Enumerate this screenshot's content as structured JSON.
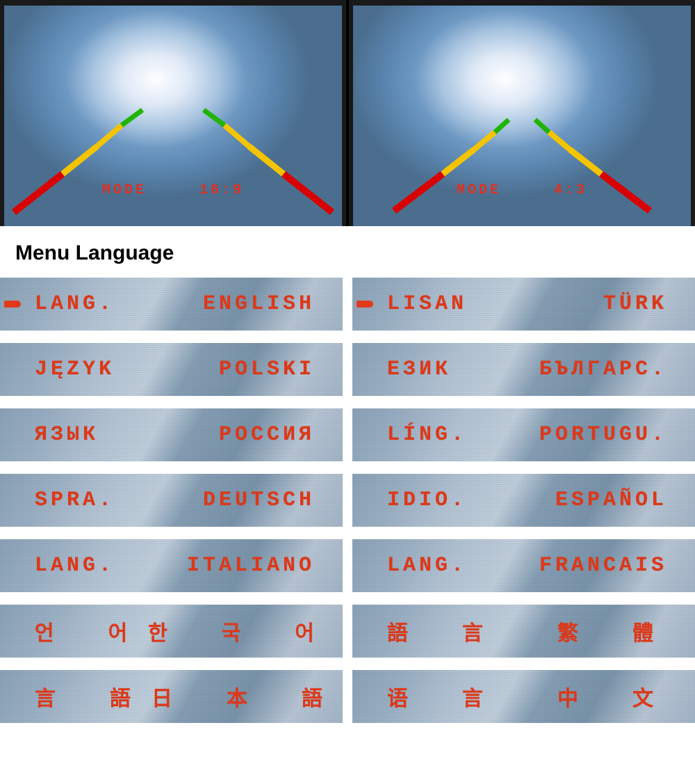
{
  "screens": {
    "left": {
      "mode_label": "MODE",
      "aspect": "16:9"
    },
    "right": {
      "mode_label": "MODE",
      "aspect": "4:3"
    }
  },
  "heading": "Menu Language",
  "languages": [
    {
      "label": "LANG.",
      "value": "ENGLISH",
      "indicator": true,
      "spaced": false
    },
    {
      "label": "LISAN",
      "value": "TÜRK",
      "indicator": true,
      "spaced": false
    },
    {
      "label": "JĘZYK",
      "value": "POLSKI",
      "indicator": false,
      "spaced": false
    },
    {
      "label": "ЕЗИК",
      "value": "БЪЛГАРС.",
      "indicator": false,
      "spaced": false
    },
    {
      "label": "ЯЗЫК",
      "value": "РОССИЯ",
      "indicator": false,
      "spaced": false
    },
    {
      "label": "LÍNG.",
      "value": "PORTUGU.",
      "indicator": false,
      "spaced": false
    },
    {
      "label": "SPRA.",
      "value": "DEUTSCH",
      "indicator": false,
      "spaced": false
    },
    {
      "label": "IDIO.",
      "value": "ESPAÑOL",
      "indicator": false,
      "spaced": false
    },
    {
      "label": "LANG.",
      "value": "ITALIANO",
      "indicator": false,
      "spaced": false
    },
    {
      "label": "LANG.",
      "value": "FRANCAIS",
      "indicator": false,
      "spaced": false
    },
    {
      "label": "언 어",
      "value": "한 국 어",
      "indicator": false,
      "spaced": true
    },
    {
      "label": "語 言",
      "value": "繁 體",
      "indicator": false,
      "spaced": true
    },
    {
      "label": "言 語",
      "value": "日 本 語",
      "indicator": false,
      "spaced": true
    },
    {
      "label": "语 言",
      "value": "中 文",
      "indicator": false,
      "spaced": true
    }
  ]
}
